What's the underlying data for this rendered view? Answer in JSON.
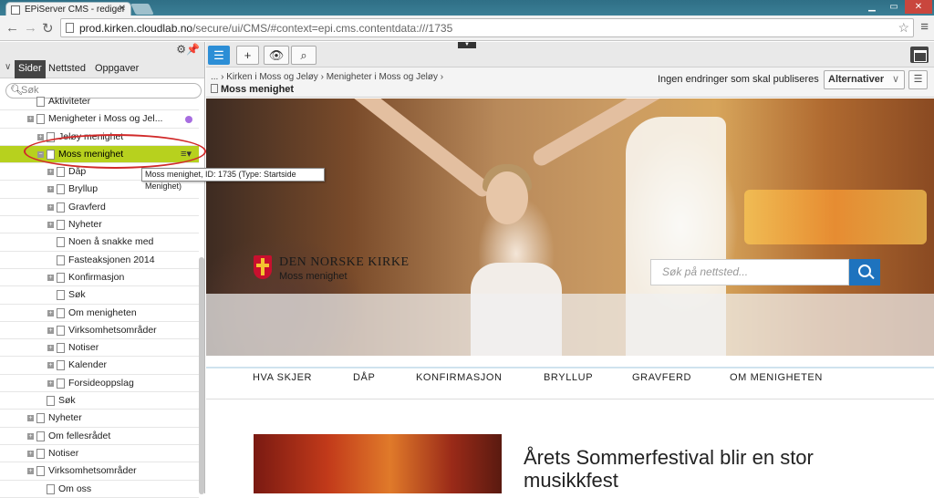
{
  "browser": {
    "tab_title": "EPiServer CMS - rediger",
    "url_host": "prod.kirken.cloudlab.no",
    "url_path": "/secure/ui/CMS/#context=epi.cms.contentdata:///1735"
  },
  "left_panel": {
    "tabs": [
      "Sider",
      "Nettsted",
      "Oppgaver"
    ],
    "search_placeholder": "Søk",
    "tree": [
      {
        "label": "Aktiviteter",
        "indent": 2,
        "expander": false
      },
      {
        "label": "Menigheter i Moss og Jel...",
        "indent": 2,
        "expander": true
      },
      {
        "label": "Jeløy menighet",
        "indent": 3,
        "expander": true
      },
      {
        "label": "Moss menighet",
        "indent": 3,
        "expander": true,
        "selected": true
      },
      {
        "label": "Dåp",
        "indent": 4,
        "expander": true
      },
      {
        "label": "Bryllup",
        "indent": 4,
        "expander": true
      },
      {
        "label": "Gravferd",
        "indent": 4,
        "expander": true
      },
      {
        "label": "Nyheter",
        "indent": 4,
        "expander": true
      },
      {
        "label": "Noen å snakke med",
        "indent": 4,
        "expander": false
      },
      {
        "label": "Fasteaksjonen 2014",
        "indent": 4,
        "expander": false
      },
      {
        "label": "Konfirmasjon",
        "indent": 4,
        "expander": true
      },
      {
        "label": "Søk",
        "indent": 4,
        "expander": false
      },
      {
        "label": "Om menigheten",
        "indent": 4,
        "expander": true
      },
      {
        "label": "Virksomhetsområder",
        "indent": 4,
        "expander": true
      },
      {
        "label": "Notiser",
        "indent": 4,
        "expander": true
      },
      {
        "label": "Kalender",
        "indent": 4,
        "expander": true
      },
      {
        "label": "Forsideoppslag",
        "indent": 4,
        "expander": true
      },
      {
        "label": "Søk",
        "indent": 3,
        "expander": false
      },
      {
        "label": "Nyheter",
        "indent": 2,
        "expander": true
      },
      {
        "label": "Om fellesrådet",
        "indent": 2,
        "expander": true
      },
      {
        "label": "Notiser",
        "indent": 2,
        "expander": true
      },
      {
        "label": "Virksomhetsområder",
        "indent": 2,
        "expander": true
      },
      {
        "label": "Om oss",
        "indent": 3,
        "expander": false
      }
    ],
    "tooltip": "Moss menighet, ID: 1735 (Type: Startside Menighet)"
  },
  "main": {
    "breadcrumb": "... › Kirken i Moss og Jeløy › Menigheter i Moss og Jeløy ›",
    "page_title": "Moss menighet",
    "publish_status": "Ingen endringer som skal publiseres",
    "options_label": "Alternativer"
  },
  "preview": {
    "brand": "DEN NORSKE KIRKE",
    "subtitle": "Moss menighet",
    "search_placeholder": "Søk på nettsted...",
    "menu": [
      "HVA SKJER",
      "DÅP",
      "KONFIRMASJON",
      "BRYLLUP",
      "GRAVFERD",
      "OM MENIGHETEN"
    ],
    "article_title": "Årets Sommerfestival blir en stor musikkfest"
  },
  "colors": {
    "selected_row": "#b7d11e",
    "accent_blue": "#2c8ed6",
    "search_button": "#1e73be",
    "highlight_circle": "#d12a2a"
  }
}
